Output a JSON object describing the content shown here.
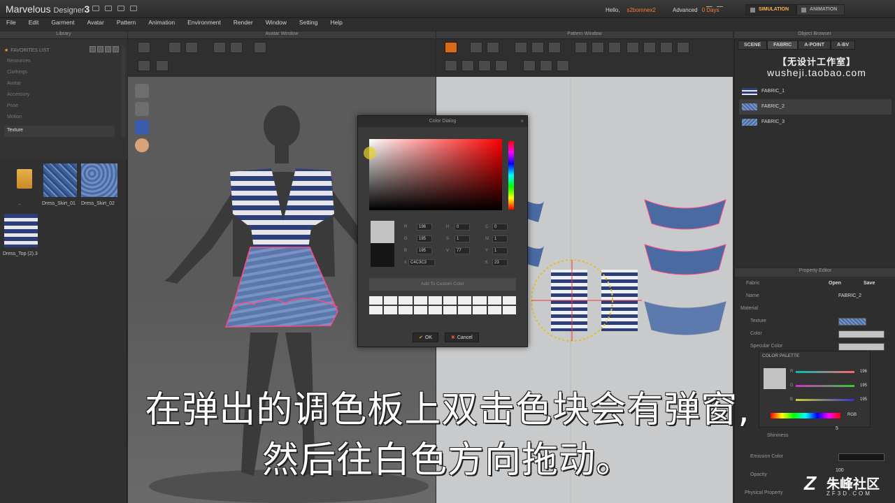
{
  "app": {
    "title_main": "Marvelous",
    "title_sub": "Designer",
    "title_num": "3",
    "hello_label": "Hello,",
    "user": "s2bomnex2",
    "license": "Advanced",
    "days": "0 Days",
    "mode_tabs": [
      "SIMULATION",
      "ANIMATION"
    ]
  },
  "menu": [
    "File",
    "Edit",
    "Garment",
    "Avatar",
    "Pattern",
    "Animation",
    "Environment",
    "Render",
    "Window",
    "Setting",
    "Help"
  ],
  "panels": {
    "library": "Library",
    "avatar": "Avatar Window",
    "pattern": "Pattern Window",
    "object_browser": "Object Browser",
    "property_editor": "Property Editor"
  },
  "library": {
    "favorites": "FAVORITES LIST",
    "entries": [
      "Resources",
      "Clothings",
      "Avatar",
      "Accessory",
      "Pose",
      "Motion",
      "Texture"
    ],
    "selected": "Texture",
    "thumbs": [
      "..",
      "Dress_Skirt_01",
      "Dress_Skirt_02",
      "Dress_Top (2).3"
    ]
  },
  "object_browser": {
    "tabs": [
      "SCENE",
      "FABRIC",
      "A-POINT",
      "A-BV"
    ],
    "watermark_line1": "【无设计工作室】",
    "watermark_line2": "wusheji.taobao.com",
    "fabrics": [
      "FABRIC_1",
      "FABRIC_2",
      "FABRIC_3"
    ],
    "selected_fabric": "FABRIC_2"
  },
  "property_editor": {
    "fabric_label": "Fabric",
    "open": "Open",
    "save": "Save",
    "name_label": "Name",
    "name_value": "FABRIC_2",
    "material": "Material",
    "texture": "Texture",
    "color": "Color",
    "specular": "Specular Color",
    "palette_title": "COLOR PALETTE",
    "r_label": "R",
    "g_label": "G",
    "b_label": "B",
    "r": "196",
    "g": "195",
    "b": "195",
    "mode": "RGB",
    "shininess": "Shininess",
    "shininess_value": "5",
    "emission": "Emission Color",
    "opacity": "Opacity",
    "opacity_value": "100",
    "physical": "Physical Property"
  },
  "color_dialog": {
    "title": "Color Dialog",
    "r_label": "R",
    "g_label": "G",
    "b_label": "B",
    "h_label": "H",
    "s_label": "S",
    "v_label": "V",
    "c_label": "C",
    "m_label": "M",
    "y_label": "Y",
    "k_label": "K",
    "r": "196",
    "g": "195",
    "b": "195",
    "h": "0",
    "s": "1",
    "v": "77",
    "c": "0",
    "m": "1",
    "y": "1",
    "k": "23",
    "hex_label": "#",
    "hex": "C4C3C3",
    "add_custom": "Add To Custom Color",
    "ok": "OK",
    "cancel": "Cancel"
  },
  "subtitles": {
    "line1": "在弹出的调色板上双击色块会有弹窗,",
    "line2": "然后往白色方向拖动。"
  },
  "logo": {
    "text": "朱峰社区",
    "sub": "ZF3D.COM"
  },
  "colors": {
    "accent": "#ff7a2a",
    "selected_color": "#c4c3c3",
    "fabric_blue": "#4a6aa2",
    "stripe_navy": "#2d3f78"
  }
}
